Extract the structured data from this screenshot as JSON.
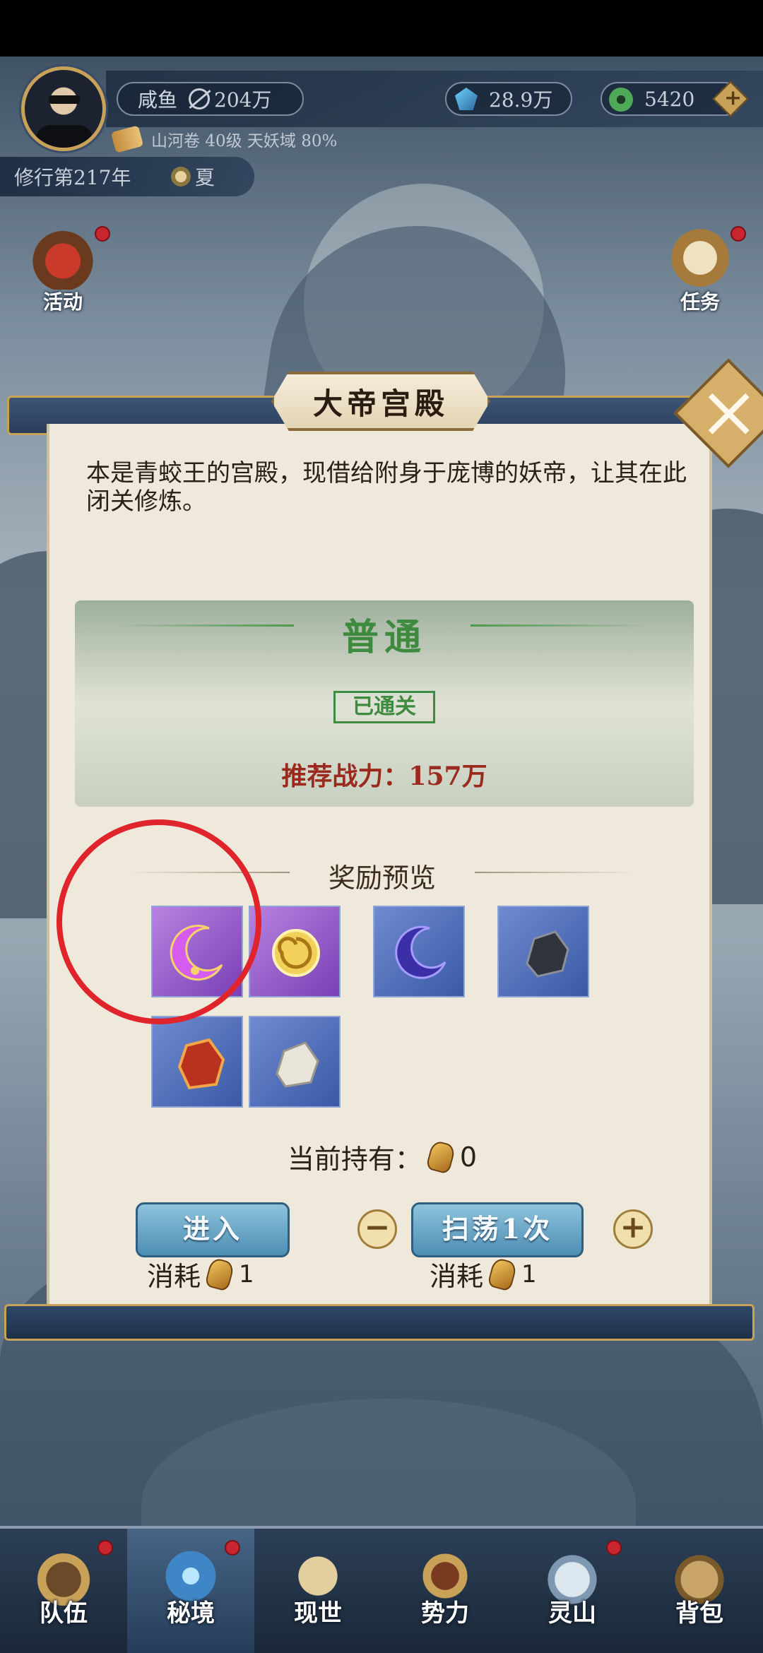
{
  "hud": {
    "player_name": "咸鱼",
    "combat_power": "204万",
    "jade": "28.9万",
    "coins": "5420",
    "scroll_info": "山河卷 40级 天妖域 80%",
    "year_label": "修行第217年",
    "season": "夏"
  },
  "side_left": [
    {
      "label": "活动"
    }
  ],
  "side_right": [
    {
      "label": "任务"
    }
  ],
  "modal": {
    "title": "大帝宫殿",
    "description": "本是青蛟王的宫殿，现借给附身于庞博的妖帝，让其在此闭关修炼。",
    "difficulty": "普通",
    "cleared_badge": "已通关",
    "recommended_power": "推荐战力：157万",
    "reward_header": "奖励预览",
    "rewards": [
      {
        "name": "purple-crescent-jewel",
        "rarity": "purple"
      },
      {
        "name": "golden-spiral-orb",
        "rarity": "purple"
      },
      {
        "name": "blue-moon-shard",
        "rarity": "blue"
      },
      {
        "name": "dark-ore",
        "rarity": "blue"
      },
      {
        "name": "red-ore",
        "rarity": "blue"
      },
      {
        "name": "white-ore",
        "rarity": "blue"
      }
    ],
    "holding_label": "当前持有：",
    "holding_count": "0",
    "enter_label": "进入",
    "sweep_label": "扫荡1次",
    "cost_label": "消耗",
    "enter_cost": "1",
    "sweep_cost": "1"
  },
  "nav": [
    {
      "label": "队伍",
      "dot": true
    },
    {
      "label": "秘境",
      "dot": true,
      "active": true
    },
    {
      "label": "现世",
      "dot": false
    },
    {
      "label": "势力",
      "dot": false
    },
    {
      "label": "灵山",
      "dot": true
    },
    {
      "label": "背包",
      "dot": false
    }
  ]
}
